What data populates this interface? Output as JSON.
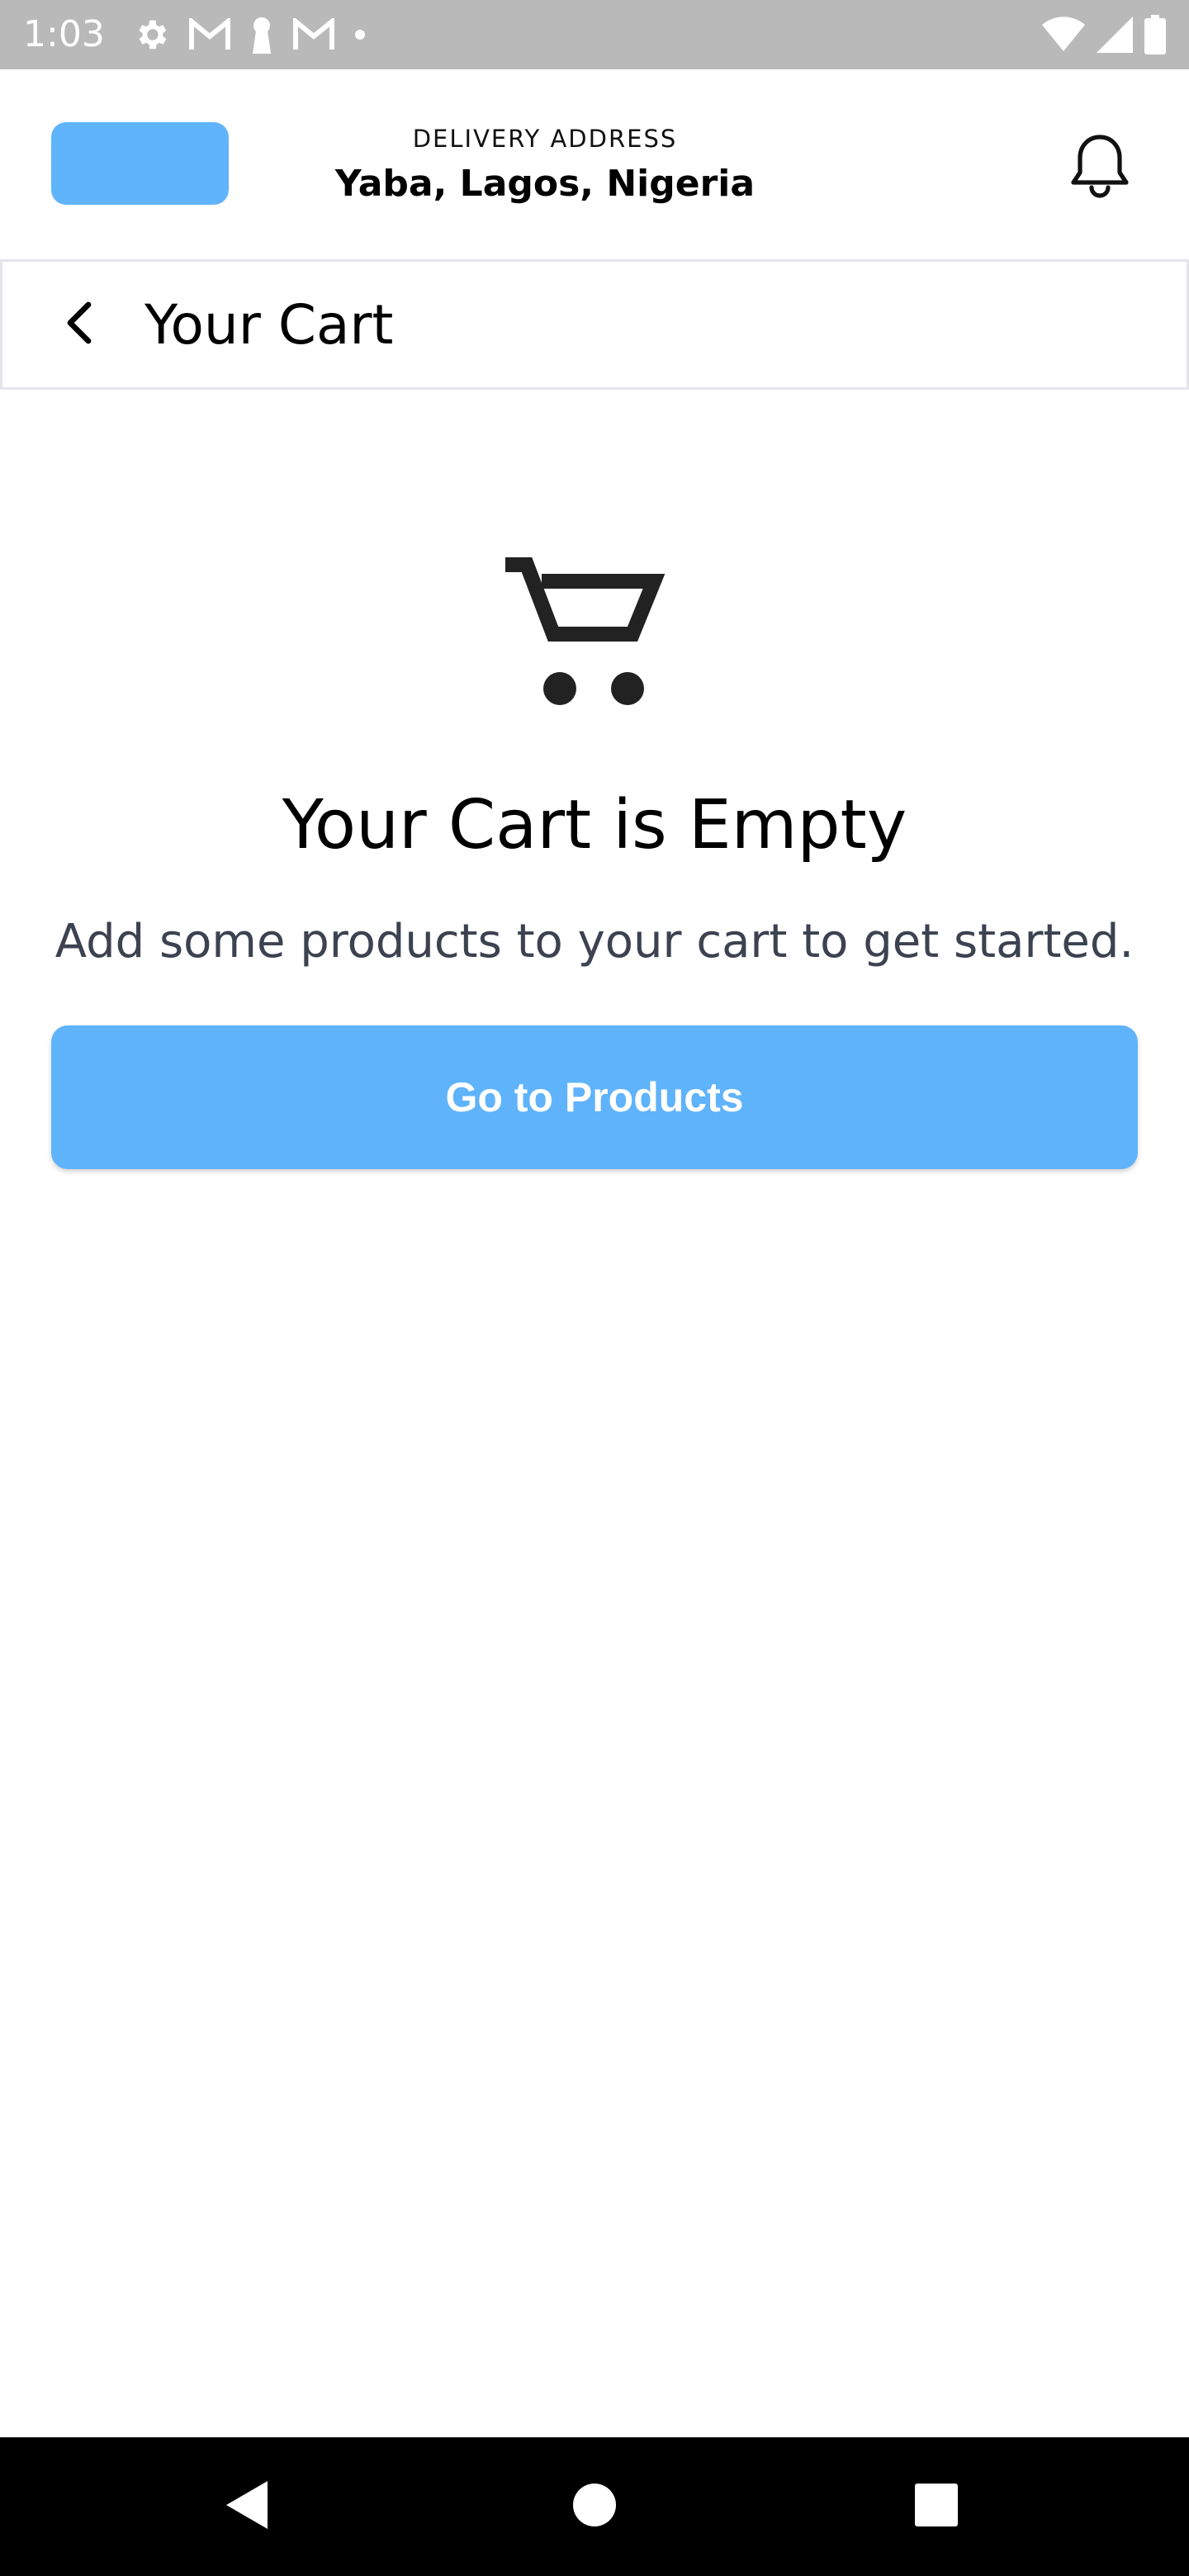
{
  "status_bar": {
    "time": "1:03",
    "left_icons": [
      "settings-icon",
      "gmail-icon",
      "keyhole-icon",
      "gmail-icon",
      "dot-icon"
    ],
    "right_icons": [
      "wifi-icon",
      "signal-icon",
      "battery-icon"
    ]
  },
  "header": {
    "delivery_label": "DELIVERY ADDRESS",
    "delivery_address": "Yaba, Lagos, Nigeria",
    "logo_color": "#60b4fb",
    "notification_icon": "bell-icon"
  },
  "title_bar": {
    "back_icon": "chevron-left-icon",
    "title": "Your Cart"
  },
  "empty_state": {
    "icon": "shopping-cart-icon",
    "title": "Your Cart is Empty",
    "subtitle": "Add some products to your cart to get started.",
    "button_label": "Go to Products",
    "button_color": "#5fb3fb"
  },
  "nav_bar": {
    "buttons": [
      "back-triangle-icon",
      "home-circle-icon",
      "recents-square-icon"
    ]
  }
}
